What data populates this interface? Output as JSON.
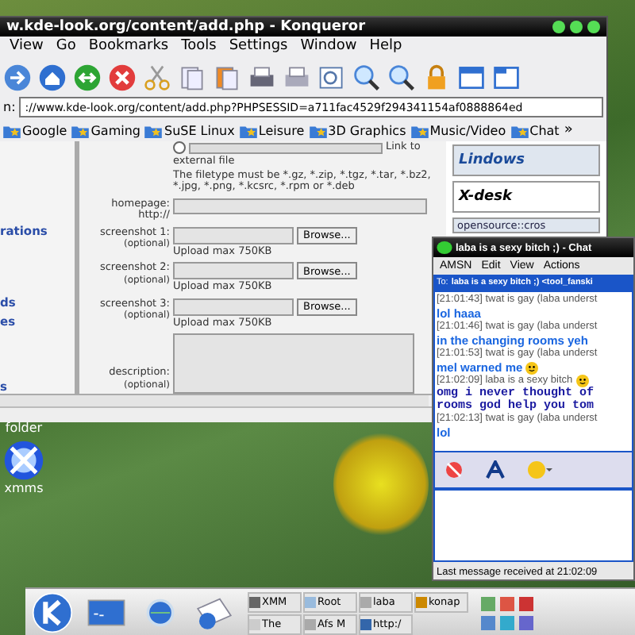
{
  "browser": {
    "title": "w.kde-look.org/content/add.php - Konqueror",
    "menu": [
      "View",
      "Go",
      "Bookmarks",
      "Tools",
      "Settings",
      "Window",
      "Help"
    ],
    "address_label": "n:",
    "url": "://www.kde-look.org/content/add.php?PHPSESSID=a711fac4529f294341154af0888864ed",
    "bookmarks": [
      "Google",
      "Gaming",
      "SuSE Linux",
      "Leisure",
      "3D Graphics",
      "Music/Video",
      "Chat"
    ],
    "overflow": "»",
    "sidebar_links": [
      "rations",
      "ds",
      "es",
      "s"
    ],
    "radio_selected": false,
    "link_to": "Link to",
    "external_file": "external file",
    "filetype_note": "The filetype must be *.gz, *.zip, *.tgz, *.tar, *.bz2, *.jpg, *.png, *.kcsrc, *.rpm or *.deb",
    "homepage": {
      "label": "homepage:",
      "sublabel": "http://"
    },
    "screenshots": [
      {
        "label": "screenshot 1:",
        "optional": "(optional)",
        "button": "Browse...",
        "hint": "Upload max 750KB"
      },
      {
        "label": "screenshot 2:",
        "optional": "(optional)",
        "button": "Browse...",
        "hint": "Upload max 750KB"
      },
      {
        "label": "screenshot 3:",
        "optional": "(optional)",
        "button": "Browse...",
        "hint": "Upload max 750KB"
      }
    ],
    "description": {
      "label": "description:",
      "optional": "(optional)"
    },
    "ads": [
      "Lindows",
      "X-desk",
      "opensource::cros"
    ]
  },
  "chat": {
    "title": "laba is a sexy bitch ;) - Chat",
    "menu": [
      "AMSN",
      "Edit",
      "View",
      "Actions"
    ],
    "to_label": "To:",
    "to": "laba is a sexy bitch ;) <tool_fanski",
    "messages": [
      {
        "kind": "meta",
        "text": "[21:01:43] twat is gay (laba underst",
        "emoticon": false
      },
      {
        "kind": "said",
        "text": "lol haaa",
        "emoticon": false
      },
      {
        "kind": "meta",
        "text": "[21:01:46] twat is gay (laba underst",
        "emoticon": false
      },
      {
        "kind": "said",
        "text": "in the changing rooms yeh",
        "emoticon": false
      },
      {
        "kind": "meta",
        "text": "[21:01:53] twat is gay (laba underst",
        "emoticon": false
      },
      {
        "kind": "said",
        "text": "mel warned me",
        "emoticon": true
      },
      {
        "kind": "meta",
        "text": "[21:02:09] laba is a sexy bitch",
        "emoticon": true
      },
      {
        "kind": "bold",
        "text": "omg i never thought of",
        "emoticon": false
      },
      {
        "kind": "bold",
        "text": "rooms god help you tom",
        "emoticon": false
      },
      {
        "kind": "meta",
        "text": "[21:02:13] twat is gay (laba underst",
        "emoticon": false
      },
      {
        "kind": "said",
        "text": "lol",
        "emoticon": false
      }
    ],
    "status": "Last message received at 21:02:09"
  },
  "desktop_icons": [
    {
      "label": "folder",
      "kind": "folder"
    },
    {
      "label": "xmms",
      "kind": "xmms"
    }
  ],
  "taskbar": {
    "tasks": [
      {
        "label": "XMM",
        "kind": "player"
      },
      {
        "label": "Root",
        "kind": "terminal"
      },
      {
        "label": "laba",
        "kind": "chat"
      },
      {
        "label": "konap",
        "kind": "hourglass"
      },
      {
        "label": "The",
        "kind": "tool"
      },
      {
        "label": "Afs M",
        "kind": "chat"
      },
      {
        "label": "http:/",
        "kind": "web"
      }
    ]
  }
}
